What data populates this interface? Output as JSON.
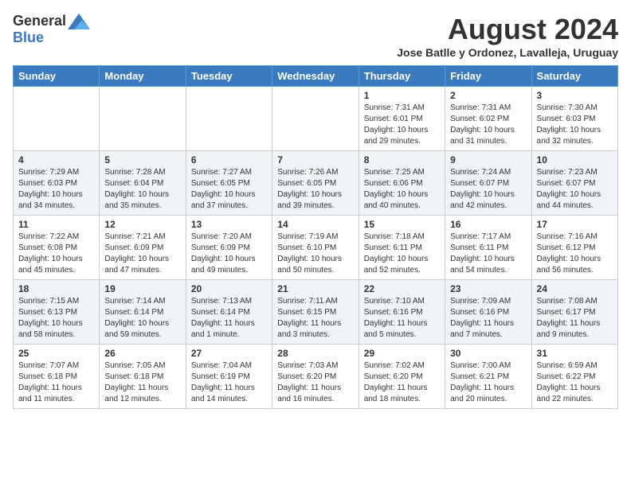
{
  "header": {
    "logo_general": "General",
    "logo_blue": "Blue",
    "title": "August 2024",
    "subtitle": "Jose Batlle y Ordonez, Lavalleja, Uruguay"
  },
  "days_of_week": [
    "Sunday",
    "Monday",
    "Tuesday",
    "Wednesday",
    "Thursday",
    "Friday",
    "Saturday"
  ],
  "weeks": [
    [
      {
        "day": "",
        "info": ""
      },
      {
        "day": "",
        "info": ""
      },
      {
        "day": "",
        "info": ""
      },
      {
        "day": "",
        "info": ""
      },
      {
        "day": "1",
        "info": "Sunrise: 7:31 AM\nSunset: 6:01 PM\nDaylight: 10 hours and 29 minutes."
      },
      {
        "day": "2",
        "info": "Sunrise: 7:31 AM\nSunset: 6:02 PM\nDaylight: 10 hours and 31 minutes."
      },
      {
        "day": "3",
        "info": "Sunrise: 7:30 AM\nSunset: 6:03 PM\nDaylight: 10 hours and 32 minutes."
      }
    ],
    [
      {
        "day": "4",
        "info": "Sunrise: 7:29 AM\nSunset: 6:03 PM\nDaylight: 10 hours and 34 minutes."
      },
      {
        "day": "5",
        "info": "Sunrise: 7:28 AM\nSunset: 6:04 PM\nDaylight: 10 hours and 35 minutes."
      },
      {
        "day": "6",
        "info": "Sunrise: 7:27 AM\nSunset: 6:05 PM\nDaylight: 10 hours and 37 minutes."
      },
      {
        "day": "7",
        "info": "Sunrise: 7:26 AM\nSunset: 6:05 PM\nDaylight: 10 hours and 39 minutes."
      },
      {
        "day": "8",
        "info": "Sunrise: 7:25 AM\nSunset: 6:06 PM\nDaylight: 10 hours and 40 minutes."
      },
      {
        "day": "9",
        "info": "Sunrise: 7:24 AM\nSunset: 6:07 PM\nDaylight: 10 hours and 42 minutes."
      },
      {
        "day": "10",
        "info": "Sunrise: 7:23 AM\nSunset: 6:07 PM\nDaylight: 10 hours and 44 minutes."
      }
    ],
    [
      {
        "day": "11",
        "info": "Sunrise: 7:22 AM\nSunset: 6:08 PM\nDaylight: 10 hours and 45 minutes."
      },
      {
        "day": "12",
        "info": "Sunrise: 7:21 AM\nSunset: 6:09 PM\nDaylight: 10 hours and 47 minutes."
      },
      {
        "day": "13",
        "info": "Sunrise: 7:20 AM\nSunset: 6:09 PM\nDaylight: 10 hours and 49 minutes."
      },
      {
        "day": "14",
        "info": "Sunrise: 7:19 AM\nSunset: 6:10 PM\nDaylight: 10 hours and 50 minutes."
      },
      {
        "day": "15",
        "info": "Sunrise: 7:18 AM\nSunset: 6:11 PM\nDaylight: 10 hours and 52 minutes."
      },
      {
        "day": "16",
        "info": "Sunrise: 7:17 AM\nSunset: 6:11 PM\nDaylight: 10 hours and 54 minutes."
      },
      {
        "day": "17",
        "info": "Sunrise: 7:16 AM\nSunset: 6:12 PM\nDaylight: 10 hours and 56 minutes."
      }
    ],
    [
      {
        "day": "18",
        "info": "Sunrise: 7:15 AM\nSunset: 6:13 PM\nDaylight: 10 hours and 58 minutes."
      },
      {
        "day": "19",
        "info": "Sunrise: 7:14 AM\nSunset: 6:14 PM\nDaylight: 10 hours and 59 minutes."
      },
      {
        "day": "20",
        "info": "Sunrise: 7:13 AM\nSunset: 6:14 PM\nDaylight: 11 hours and 1 minute."
      },
      {
        "day": "21",
        "info": "Sunrise: 7:11 AM\nSunset: 6:15 PM\nDaylight: 11 hours and 3 minutes."
      },
      {
        "day": "22",
        "info": "Sunrise: 7:10 AM\nSunset: 6:16 PM\nDaylight: 11 hours and 5 minutes."
      },
      {
        "day": "23",
        "info": "Sunrise: 7:09 AM\nSunset: 6:16 PM\nDaylight: 11 hours and 7 minutes."
      },
      {
        "day": "24",
        "info": "Sunrise: 7:08 AM\nSunset: 6:17 PM\nDaylight: 11 hours and 9 minutes."
      }
    ],
    [
      {
        "day": "25",
        "info": "Sunrise: 7:07 AM\nSunset: 6:18 PM\nDaylight: 11 hours and 11 minutes."
      },
      {
        "day": "26",
        "info": "Sunrise: 7:05 AM\nSunset: 6:18 PM\nDaylight: 11 hours and 12 minutes."
      },
      {
        "day": "27",
        "info": "Sunrise: 7:04 AM\nSunset: 6:19 PM\nDaylight: 11 hours and 14 minutes."
      },
      {
        "day": "28",
        "info": "Sunrise: 7:03 AM\nSunset: 6:20 PM\nDaylight: 11 hours and 16 minutes."
      },
      {
        "day": "29",
        "info": "Sunrise: 7:02 AM\nSunset: 6:20 PM\nDaylight: 11 hours and 18 minutes."
      },
      {
        "day": "30",
        "info": "Sunrise: 7:00 AM\nSunset: 6:21 PM\nDaylight: 11 hours and 20 minutes."
      },
      {
        "day": "31",
        "info": "Sunrise: 6:59 AM\nSunset: 6:22 PM\nDaylight: 11 hours and 22 minutes."
      }
    ]
  ]
}
